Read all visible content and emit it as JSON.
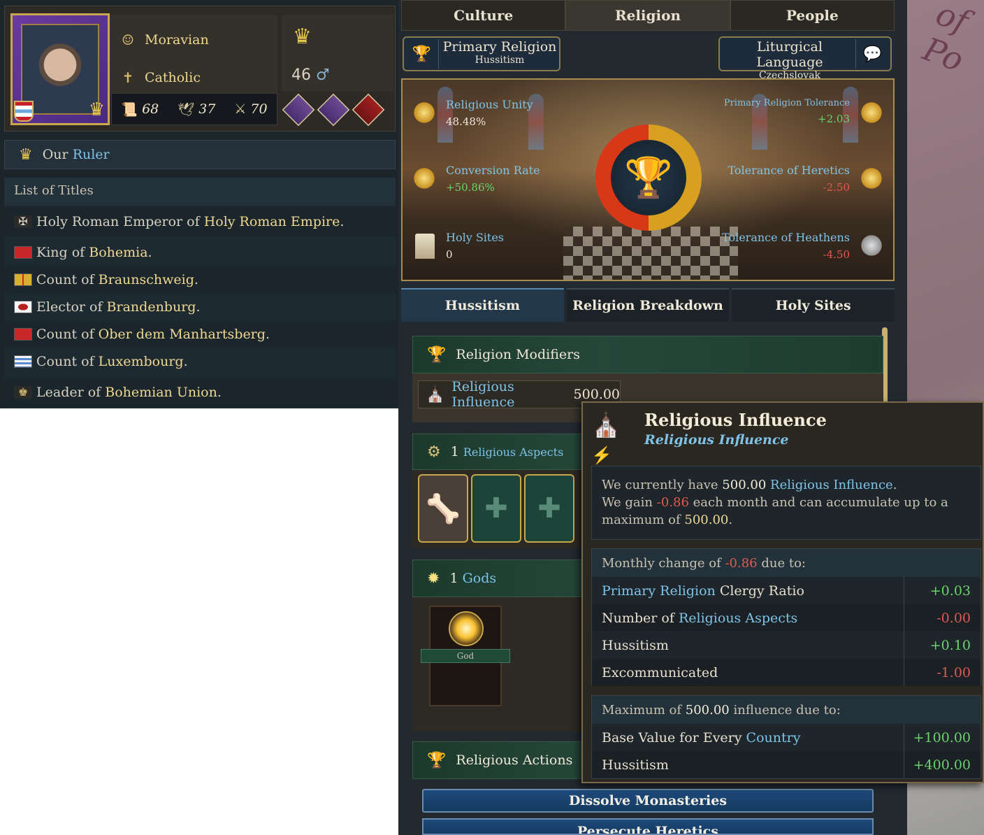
{
  "ruler": {
    "culture": "Moravian",
    "religion": "Catholic",
    "age": "46",
    "skills": [
      "68",
      "37",
      "70"
    ],
    "our_ruler_prefix": "Our",
    "our_ruler_link": "Ruler"
  },
  "titles": {
    "header": "List of Titles",
    "items": [
      {
        "role": "Holy Roman Emperor of",
        "name": "Holy Roman Empire",
        "end": "."
      },
      {
        "role": "King of",
        "name": "Bohemia",
        "end": "."
      },
      {
        "role": "Count of",
        "name": "Braunschweig",
        "end": "."
      },
      {
        "role": "Elector of",
        "name": "Brandenburg",
        "end": "."
      },
      {
        "role": "Count of",
        "name": "Ober dem Manhartsberg",
        "end": "."
      },
      {
        "role": "Count of",
        "name": "Luxembourg",
        "end": "."
      },
      {
        "role": "Leader of",
        "name": "Bohemian Union",
        "end": "."
      }
    ]
  },
  "tabs": {
    "top": [
      "Culture",
      "Religion",
      "People"
    ],
    "sub": [
      "Hussitism",
      "Religion Breakdown",
      "Holy Sites"
    ]
  },
  "primary_religion": {
    "label": "Primary Religion",
    "value": "Hussitism"
  },
  "liturgical_language": {
    "label": "Liturgical Language",
    "value": "Czechslovak"
  },
  "stats": {
    "unity": {
      "label": "Religious Unity",
      "value": "48.48%"
    },
    "conversion": {
      "label": "Conversion Rate",
      "value": "+50.86%"
    },
    "holy_sites": {
      "label": "Holy Sites",
      "value": "0"
    },
    "primary_tolerance": {
      "label": "Primary Religion Tolerance",
      "value": "+2.03"
    },
    "heretics": {
      "label": "Tolerance of Heretics",
      "value": "-2.50"
    },
    "heathens": {
      "label": "Tolerance of Heathens",
      "value": "-4.50"
    }
  },
  "sections": {
    "modifiers": "Religion Modifiers",
    "influence_label": "Religious Influence",
    "influence_value": "500.00",
    "aspects_count": "1",
    "aspects_label": "Religious Aspects",
    "gods_count": "1",
    "gods_label": "Gods",
    "god_name": "God",
    "actions": "Religious Actions",
    "dissolve": "Dissolve Monasteries",
    "next_action": "Persecute Heretics"
  },
  "tooltip": {
    "title": "Religious Influence",
    "subtitle": "Religious Influence",
    "desc": {
      "a": "We currently have",
      "b": "500.00",
      "c": "Religious Influence",
      "d": ".",
      "e": "We gain",
      "f": "-0.86",
      "g": "each month and can accumulate up to a maximum of",
      "h": "500.00",
      "i": "."
    },
    "monthly_head": {
      "a": "Monthly change of",
      "b": "-0.86",
      "c": "due to:"
    },
    "monthly_rows": [
      {
        "blue": "Primary Religion",
        "text": "Clergy Ratio",
        "value": "+0.03"
      },
      {
        "pre": "Number of",
        "blue": "Religious Aspects",
        "value": "-0.00"
      },
      {
        "text": "Hussitism",
        "value": "+0.10"
      },
      {
        "text": "Excommunicated",
        "value": "-1.00"
      }
    ],
    "max_head": {
      "a": "Maximum of",
      "b": "500.00",
      "c": "influence due to:"
    },
    "max_rows": [
      {
        "pre": "Base Value for Every",
        "blue": "Country",
        "value": "+100.00"
      },
      {
        "text": "Hussitism",
        "value": "+400.00"
      }
    ]
  },
  "map_label": "of Po",
  "colors": {
    "positive": "#6dd36d",
    "negative": "#e05a50",
    "link": "#7ec4e8",
    "highlight": "#f0d890"
  }
}
